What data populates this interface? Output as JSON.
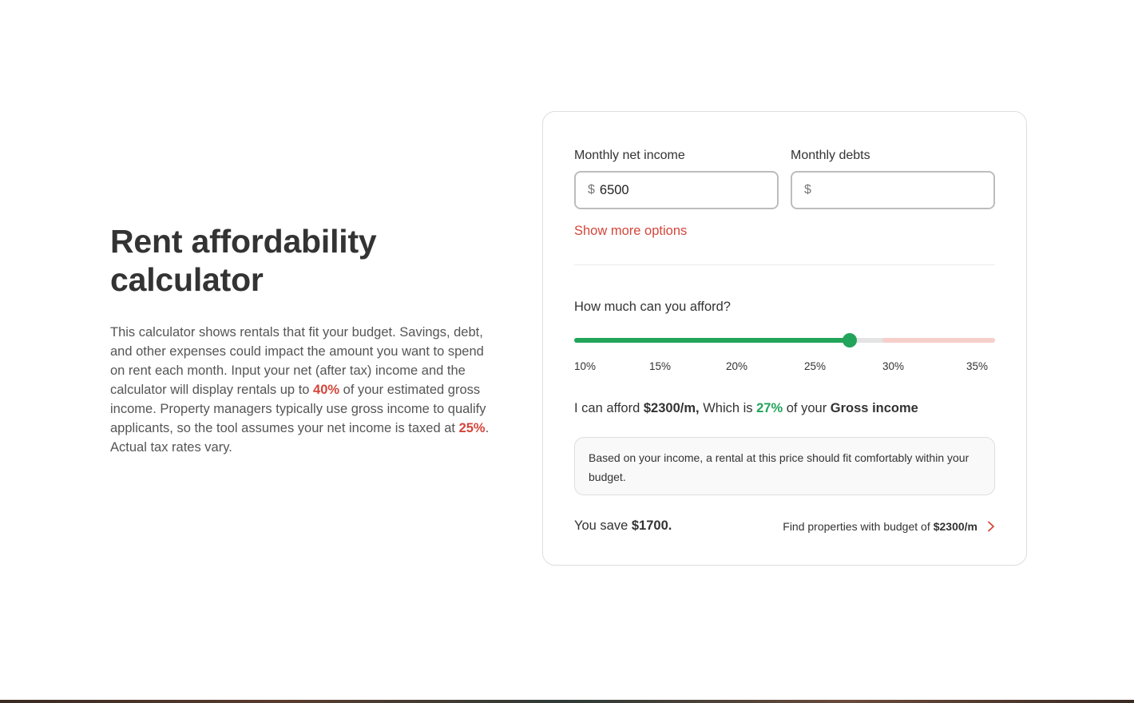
{
  "intro": {
    "title": "Rent affordability calculator",
    "desc_1": "This calculator shows rentals that fit your budget. Savings, debt, and other expenses could impact the amount you want to spend on rent each month. Input your net (after tax) income and the calculator will display rentals up to ",
    "desc_hl_1": "40%",
    "desc_2": " of your estimated gross income. Property managers typically use gross income to qualify applicants, so the tool assumes your net income is taxed at ",
    "desc_hl_2": "25%",
    "desc_3": ". Actual tax rates vary."
  },
  "calculator": {
    "income": {
      "label": "Monthly net income",
      "currency": "$",
      "value": "6500",
      "placeholder": ""
    },
    "debts": {
      "label": "Monthly debts",
      "currency": "$",
      "value": "",
      "placeholder": ""
    },
    "more_options": "Show more options",
    "question": "How much can you afford?",
    "slider": {
      "min_pct": 10,
      "max_pct": 36,
      "value_pct": 27,
      "comfort_max_pct": 30,
      "ticks": [
        "10%",
        "15%",
        "20%",
        "25%",
        "30%",
        "35%"
      ],
      "colors": {
        "fill": "#22a45a",
        "danger": "#f7cfca",
        "track": "#e4e4e4"
      }
    },
    "afford": {
      "prefix": "I can afford",
      "amount": "$2300/m,",
      "which_is": "Which is",
      "pct": "27%",
      "of_your": "of your",
      "basis": "Gross income"
    },
    "note": "Based on your income, a rental at this price should fit comfortably within your budget.",
    "save": {
      "prefix": "You save",
      "amount": "$1700."
    },
    "find": {
      "label": "Find properties with budget of",
      "amount": "$2300/m",
      "icon": "chevron-right-icon"
    }
  },
  "colors": {
    "accent_red": "#d4463b",
    "accent_green": "#22a45a"
  }
}
